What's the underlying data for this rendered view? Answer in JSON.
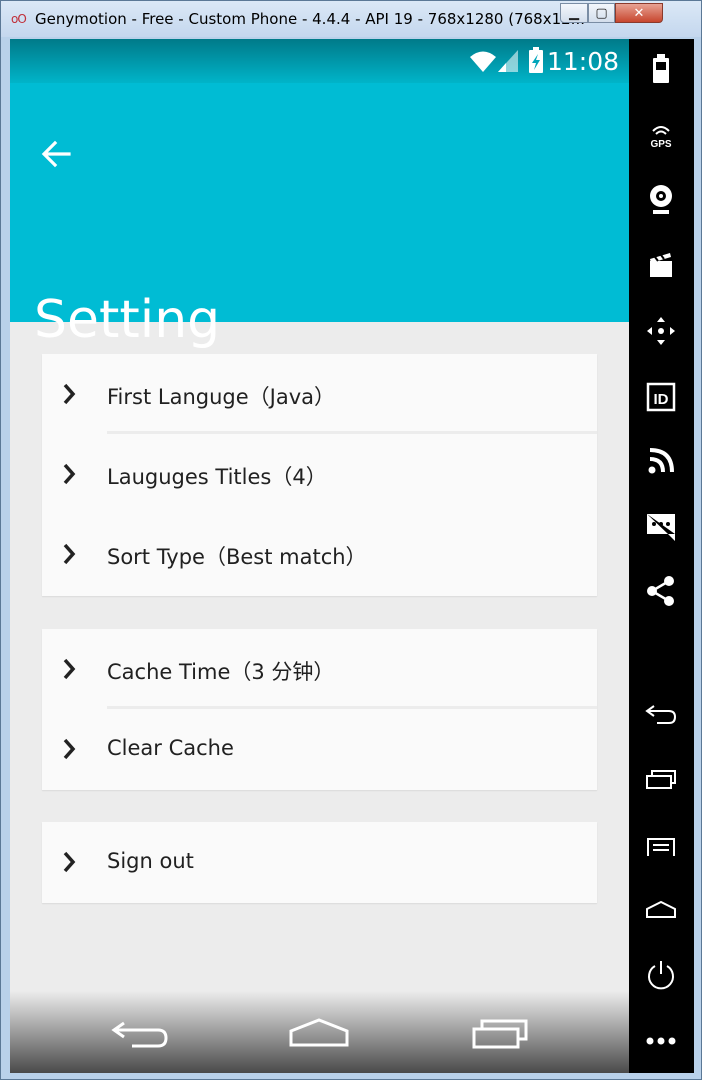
{
  "window": {
    "title": "Genymotion - Free - Custom Phone - 4.4.4 - API 19 - 768x1280 (768x12...",
    "app_icon": "oO",
    "minimize_icon": "minimize-icon",
    "maximize_icon": "maximize-icon",
    "close_icon": "close-icon"
  },
  "statusbar": {
    "time": "11:08",
    "icons": [
      "wifi-icon",
      "signal-icon",
      "battery-charging-icon"
    ]
  },
  "appbar": {
    "title": "Setting",
    "back_icon": "back-arrow-icon",
    "color": "#00bcd4"
  },
  "settings": {
    "group1": [
      {
        "label": "First Languge（Java）"
      },
      {
        "label": "Lauguges Titles（4）"
      },
      {
        "label": "Sort Type（Best match）"
      }
    ],
    "group2": [
      {
        "label": "Cache Time（3 分钟）"
      },
      {
        "label": "Clear Cache"
      }
    ],
    "group3": [
      {
        "label": "Sign out"
      }
    ]
  },
  "navbar": {
    "buttons": [
      "back-icon",
      "home-icon",
      "recent-apps-icon"
    ]
  },
  "tools": [
    "battery-icon",
    "gps-icon",
    "webcam-icon",
    "clapperboard-icon",
    "dpad-icon",
    "id-icon",
    "rss-icon",
    "sms-icon",
    "share-icon",
    "back-icon",
    "recent-apps-icon",
    "menu-icon",
    "home-icon",
    "power-icon",
    "more-icon"
  ],
  "tools_labels": {
    "gps": "GPS",
    "id": "ID"
  }
}
